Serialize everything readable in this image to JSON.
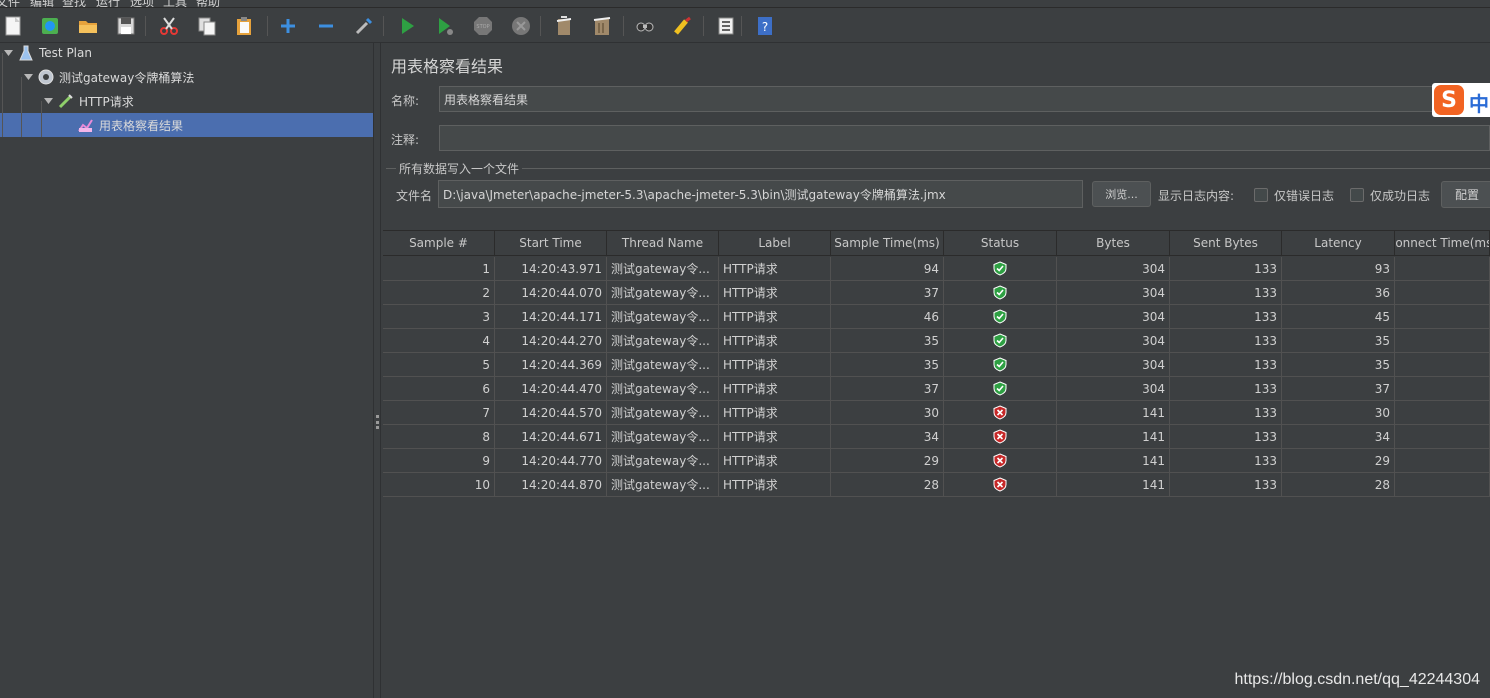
{
  "menubar": {
    "items": [
      "文件",
      "编辑",
      "查找",
      "运行",
      "选项",
      "工具",
      "帮助"
    ]
  },
  "toolbar": {
    "buttons": [
      "new-icon",
      "templates-icon",
      "open-icon",
      "save-icon",
      "cut-icon",
      "copy-icon",
      "paste-icon",
      "expand-icon",
      "collapse-icon",
      "toggle-icon",
      "start-icon",
      "start-no-pause-icon",
      "stop-icon",
      "shutdown-icon",
      "clear-icon",
      "clear-all-icon",
      "search-icon",
      "reset-search-icon",
      "function-helper-icon",
      "help-icon"
    ]
  },
  "tree": {
    "items": [
      {
        "label": "Test Plan",
        "icon": "test-plan-icon",
        "level": 0
      },
      {
        "label": "测试gateway令牌桶算法",
        "icon": "gear-icon",
        "level": 1
      },
      {
        "label": "HTTP请求",
        "icon": "pipette-icon",
        "level": 2
      },
      {
        "label": "用表格察看结果",
        "icon": "graph-icon",
        "level": 3,
        "selected": true
      }
    ]
  },
  "panel": {
    "title": "用表格察看结果",
    "name_label": "名称:",
    "name_value": "用表格察看结果",
    "comment_label": "注释:",
    "comment_value": "",
    "file_group_title": "所有数据写入一个文件",
    "filename_label": "文件名",
    "filename_value": "D:\\java\\Jmeter\\apache-jmeter-5.3\\apache-jmeter-5.3\\bin\\测试gateway令牌桶算法.jmx",
    "browse_label": "浏览...",
    "log_label": "显示日志内容:",
    "errors_only_label": "仅错误日志",
    "success_only_label": "仅成功日志",
    "configure_label": "配置"
  },
  "table": {
    "columns": [
      "Sample #",
      "Start Time",
      "Thread Name",
      "Label",
      "Sample Time(ms)",
      "Status",
      "Bytes",
      "Sent Bytes",
      "Latency",
      "Connect Time(ms)"
    ],
    "rows": [
      {
        "sample": "1",
        "start": "14:20:43.971",
        "thread": "测试gateway令...",
        "label": "HTTP请求",
        "time": "94",
        "status": "success",
        "bytes": "304",
        "sent": "133",
        "latency": "93",
        "connect": ""
      },
      {
        "sample": "2",
        "start": "14:20:44.070",
        "thread": "测试gateway令...",
        "label": "HTTP请求",
        "time": "37",
        "status": "success",
        "bytes": "304",
        "sent": "133",
        "latency": "36",
        "connect": ""
      },
      {
        "sample": "3",
        "start": "14:20:44.171",
        "thread": "测试gateway令...",
        "label": "HTTP请求",
        "time": "46",
        "status": "success",
        "bytes": "304",
        "sent": "133",
        "latency": "45",
        "connect": ""
      },
      {
        "sample": "4",
        "start": "14:20:44.270",
        "thread": "测试gateway令...",
        "label": "HTTP请求",
        "time": "35",
        "status": "success",
        "bytes": "304",
        "sent": "133",
        "latency": "35",
        "connect": ""
      },
      {
        "sample": "5",
        "start": "14:20:44.369",
        "thread": "测试gateway令...",
        "label": "HTTP请求",
        "time": "35",
        "status": "success",
        "bytes": "304",
        "sent": "133",
        "latency": "35",
        "connect": ""
      },
      {
        "sample": "6",
        "start": "14:20:44.470",
        "thread": "测试gateway令...",
        "label": "HTTP请求",
        "time": "37",
        "status": "success",
        "bytes": "304",
        "sent": "133",
        "latency": "37",
        "connect": ""
      },
      {
        "sample": "7",
        "start": "14:20:44.570",
        "thread": "测试gateway令...",
        "label": "HTTP请求",
        "time": "30",
        "status": "error",
        "bytes": "141",
        "sent": "133",
        "latency": "30",
        "connect": ""
      },
      {
        "sample": "8",
        "start": "14:20:44.671",
        "thread": "测试gateway令...",
        "label": "HTTP请求",
        "time": "34",
        "status": "error",
        "bytes": "141",
        "sent": "133",
        "latency": "34",
        "connect": ""
      },
      {
        "sample": "9",
        "start": "14:20:44.770",
        "thread": "测试gateway令...",
        "label": "HTTP请求",
        "time": "29",
        "status": "error",
        "bytes": "141",
        "sent": "133",
        "latency": "29",
        "connect": ""
      },
      {
        "sample": "10",
        "start": "14:20:44.870",
        "thread": "测试gateway令...",
        "label": "HTTP请求",
        "time": "28",
        "status": "error",
        "bytes": "141",
        "sent": "133",
        "latency": "28",
        "connect": ""
      }
    ]
  },
  "ime": {
    "logo": "S",
    "mode": "中"
  },
  "watermark": "https://blog.csdn.net/qq_42244304",
  "colors": {
    "background": "#3c3f41",
    "selection": "#4b6eaf",
    "success": "#2ea043",
    "error": "#c62828"
  }
}
